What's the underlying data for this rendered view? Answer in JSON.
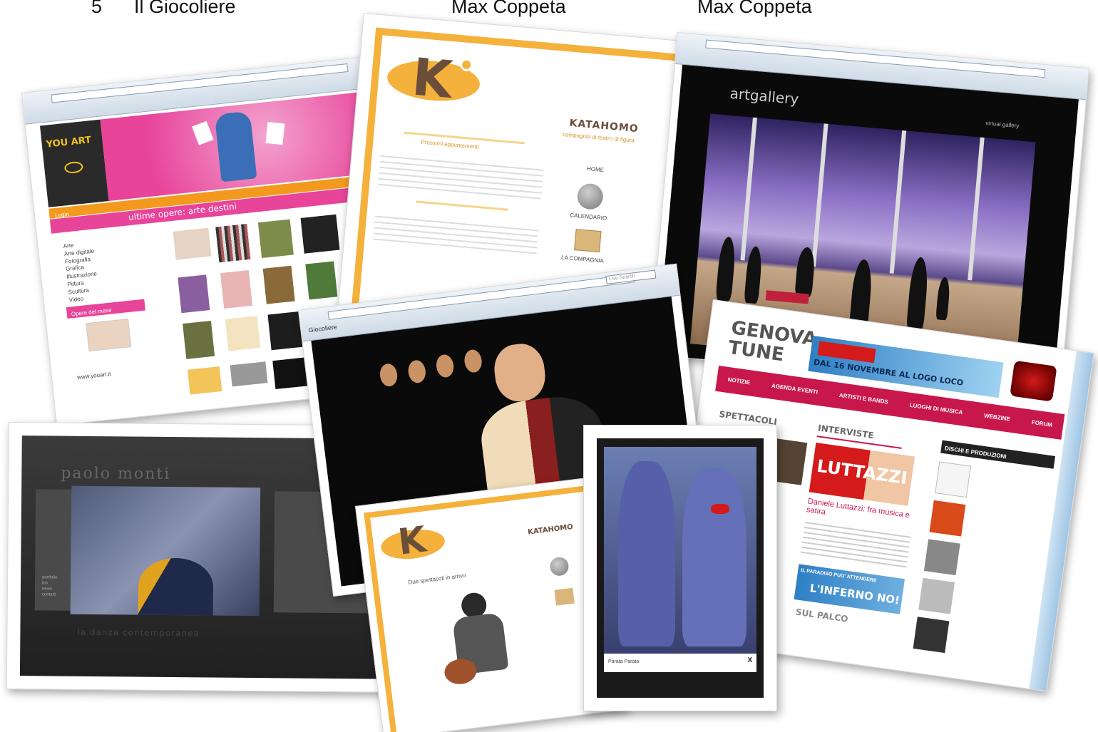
{
  "header": {
    "number": "5",
    "col1": "Il Giocoliere",
    "col2": "Max Coppeta",
    "col3": "Max Coppeta"
  },
  "youart": {
    "logo": "YOU ART",
    "banner": "ultime opere: arte destini",
    "nav_label": "Login",
    "sidebar_items": [
      "Arte",
      "Arte digitale",
      "Fotografia",
      "Grafica",
      "Illustrazione",
      "Pittura",
      "Scultura",
      "Video"
    ],
    "promo": "Opere del mese",
    "footer_link": "www.youart.it",
    "colors": {
      "pink": "#e8449a",
      "orange": "#f39a1e",
      "yellow": "#e9d21a"
    }
  },
  "katahomo": {
    "brand": "KATAHOMO",
    "subtitle": "compagnia di teatro di figura",
    "menu": [
      "HOME",
      "CALENDARIO",
      "LA COMPAGNIA"
    ],
    "news_title": "Prossimi appuntamenti",
    "colors": {
      "orange": "#f4b13c",
      "brown": "#6b4e3a"
    }
  },
  "artgallery": {
    "logo": "artgallery",
    "tagline": "virtual gallery",
    "colors": {
      "purple": "#8a6fc4"
    }
  },
  "stage": {
    "chrome_tab": "Giocoliere",
    "search_placeholder": "Live Search"
  },
  "portfolio": {
    "title": "paolo monti",
    "menu": [
      "portfolio",
      "bio",
      "news",
      "contatti"
    ],
    "caption": "la danza contemporanea"
  },
  "genova": {
    "logo_line1": "GENOVA",
    "logo_line2": "TUNE",
    "banner": "DAL 16 NOVEMBRE AL LOGO LOCO",
    "nav": [
      "NOTIZIE",
      "AGENDA EVENTI",
      "ARTISTI E BANDS",
      "LUOGHI DI MUSICA",
      "WEBZINE",
      "FORUM"
    ],
    "sections": [
      "SPETTACOLI",
      "INTERVISTE",
      "DISCHI E PRODUZIONI",
      "SUL PALCO"
    ],
    "headline": "Daniele Luttazzi: fra musica e satira",
    "interview_banner": "LUTTAZZI",
    "promo_line1": "IL PARADISO PUO' ATTENDERE",
    "promo_line2": "L'INFERNO NO!",
    "colors": {
      "red": "#c8174b",
      "blue": "#2e7fc4"
    }
  },
  "katahomo2": {
    "brand": "KATAHOMO",
    "news": "Due spettacoli in arrivo"
  },
  "photo": {
    "caption": "Parata Parata",
    "close": "X"
  }
}
